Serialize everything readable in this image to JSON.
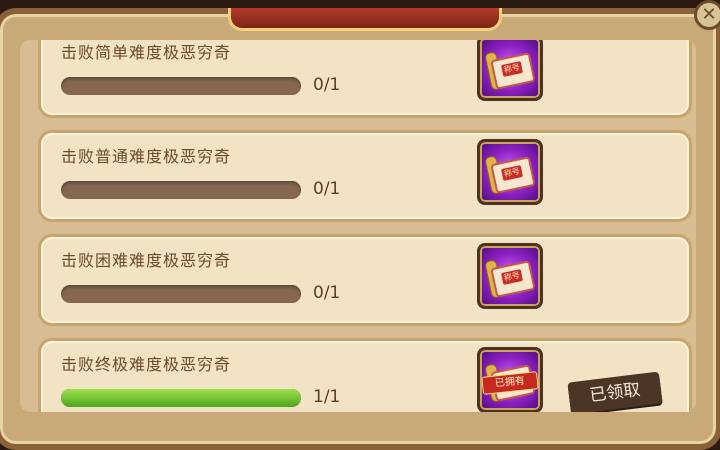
{
  "tasks": [
    {
      "title": "击败简单难度极恶穷奇",
      "progress_text": "0/1",
      "progress": 0
    },
    {
      "title": "击败普通难度极恶穷奇",
      "progress_text": "0/1",
      "progress": 0
    },
    {
      "title": "击败困难难度极恶穷奇",
      "progress_text": "0/1",
      "progress": 0
    },
    {
      "title": "击败终极难度极恶穷奇",
      "progress_text": "1/1",
      "progress": 1,
      "owned_label": "已拥有",
      "claimed_label": "已领取"
    }
  ],
  "reward_icon": {
    "seal_text": "称号",
    "icon_name": "title-scroll-icon"
  },
  "close_icon": "close-icon",
  "colors": {
    "card_bg": "#f2e3c5",
    "bar_track": "#85684f",
    "bar_fill": "#4da51c",
    "reward_bg": "#8a1fc0",
    "claimed_bg": "#4a3527"
  }
}
